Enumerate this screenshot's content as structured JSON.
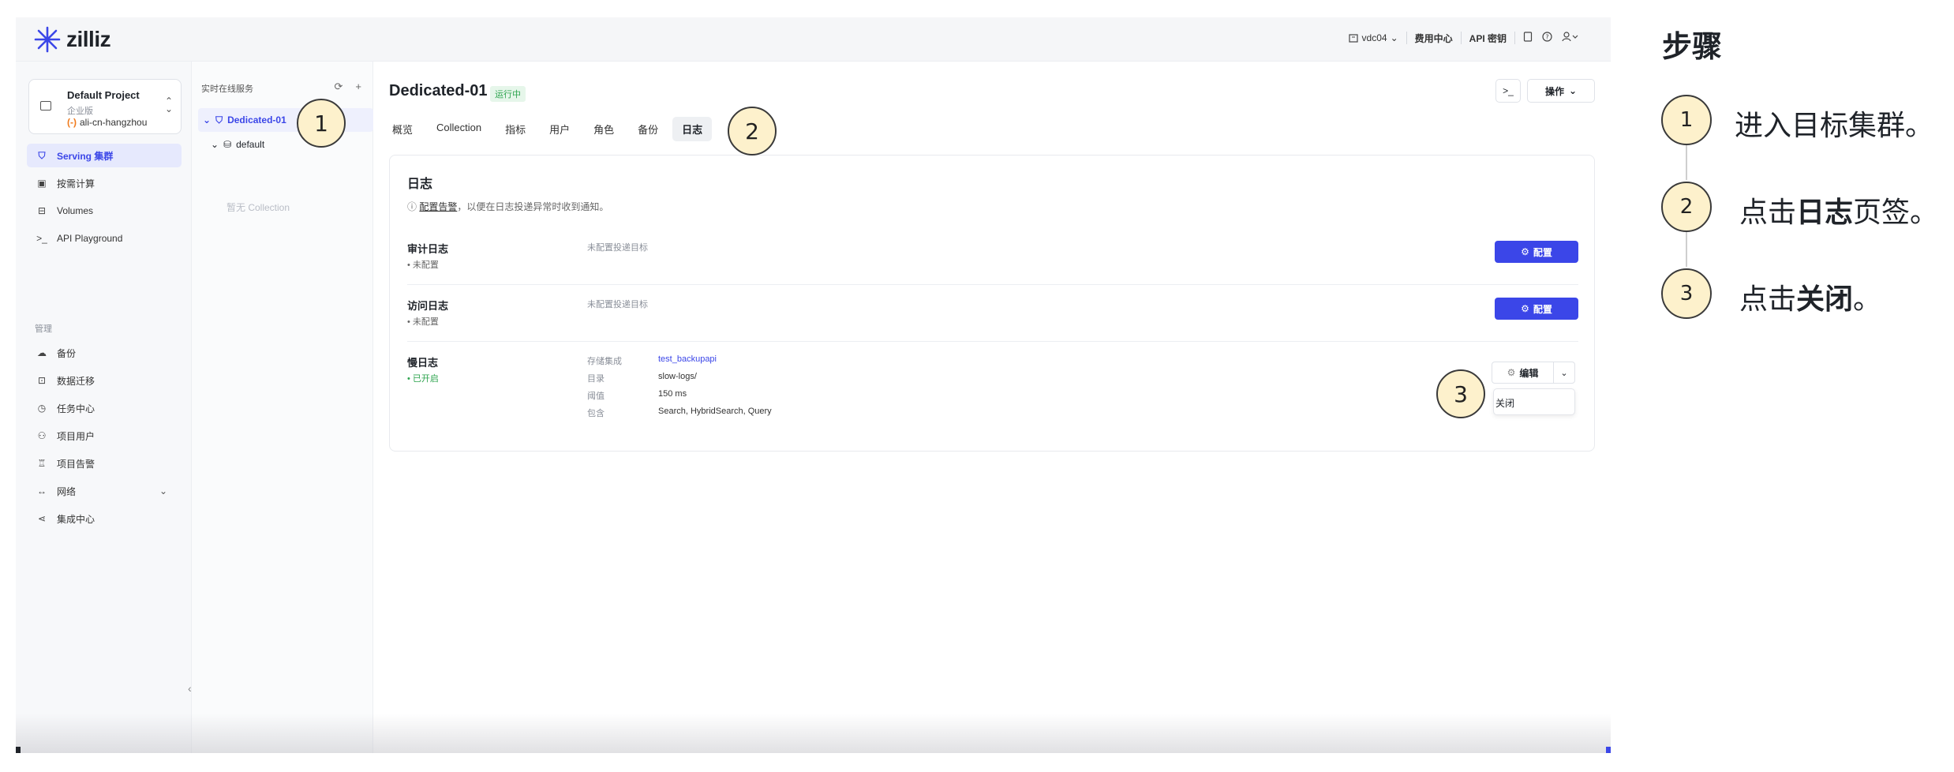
{
  "topbar": {
    "brand": "zilliz",
    "org": "vdc04",
    "billing": "费用中心",
    "api_keys": "API 密钥"
  },
  "project": {
    "name": "Default Project",
    "tier": "企业版",
    "region_prefix": "(-)",
    "region": "ali-cn-hangzhou"
  },
  "nav": {
    "items": [
      {
        "label": "Serving 集群",
        "icon": "cluster-icon",
        "active": true
      },
      {
        "label": "按需计算",
        "icon": "compute-icon",
        "active": false
      },
      {
        "label": "Volumes",
        "icon": "volume-icon",
        "active": false
      },
      {
        "label": "API Playground",
        "icon": "terminal-icon",
        "active": false
      }
    ],
    "section_label": "管理",
    "manage_items": [
      {
        "label": "备份",
        "icon": "cloud-backup-icon"
      },
      {
        "label": "数据迁移",
        "icon": "migration-icon"
      },
      {
        "label": "任务中心",
        "icon": "history-icon"
      },
      {
        "label": "项目用户",
        "icon": "users-icon"
      },
      {
        "label": "项目告警",
        "icon": "alarm-icon"
      },
      {
        "label": "网络",
        "icon": "network-icon"
      },
      {
        "label": "集成中心",
        "icon": "integration-icon"
      }
    ]
  },
  "tree": {
    "header": "实时在线服务",
    "cluster": "Dedicated-01",
    "database": "default",
    "empty": "暂无 Collection"
  },
  "main": {
    "title": "Dedicated-01",
    "status": "运行中",
    "ops_label": "操作",
    "tabs": [
      "概览",
      "Collection",
      "指标",
      "用户",
      "角色",
      "备份",
      "日志"
    ],
    "active_tab": "日志",
    "card": {
      "title": "日志",
      "hint_link": "配置告警",
      "hint_text": "，以便在日志投递异常时收到通知。",
      "audit": {
        "title": "审计日志",
        "state": "未配置",
        "note": "未配置投递目标",
        "button": "配置"
      },
      "access": {
        "title": "访问日志",
        "state": "未配置",
        "note": "未配置投递目标",
        "button": "配置"
      },
      "slow": {
        "title": "慢日志",
        "state": "已开启",
        "fields": [
          {
            "k": "存储集成",
            "v": "test_backupapi"
          },
          {
            "k": "目录",
            "v": "slow-logs/"
          },
          {
            "k": "阈值",
            "v": "150 ms"
          },
          {
            "k": "包含",
            "v": "Search, HybridSearch, Query"
          }
        ],
        "edit": "编辑",
        "menu_close": "关闭"
      }
    }
  },
  "markers": [
    "1",
    "2",
    "3"
  ],
  "steps": {
    "title": "步骤",
    "list": [
      {
        "num": "1",
        "pre": "进入目标集群。",
        "bold": "",
        "post": ""
      },
      {
        "num": "2",
        "pre": "点击",
        "bold": "日志",
        "post": "页签。"
      },
      {
        "num": "3",
        "pre": "点击",
        "bold": "关闭",
        "post": "。"
      }
    ]
  },
  "colors": {
    "accent": "#3b46e8",
    "success": "#2ea44f",
    "marker_fill": "#fdf1cc"
  }
}
